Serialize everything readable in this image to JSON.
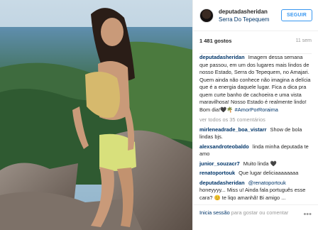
{
  "header": {
    "username": "deputadasheridan",
    "location": "Serra Do Tepequem",
    "follow_label": "SEGUIR"
  },
  "stats": {
    "likes": "1 481 gostos",
    "time_ago": "11 sem"
  },
  "caption": {
    "user": "deputadasheridan",
    "text": "Imagem dessa semana que passou, em um dos lugares mais lindos de nosso Estado, Serra do Tepequem, no Amajari. Quem ainda não conhece não imagina a delícia que é a energia daquele lugar. Fica a dica pra quem curte banho de cachoeira e uma vista maravilhosa! Nosso Estado é realmente lindo!",
    "signoff": "Bom dia!🖤🌴",
    "hashtag": "#AmorPorRoraima"
  },
  "view_all": "ver todos os 35 comentários",
  "comments": [
    {
      "user": "mirleneadrade_boa_vistarr",
      "text": "Show de bola lindas bjs."
    },
    {
      "user": "alexsandroteobaldo",
      "text": "linda minha deputada te amo"
    },
    {
      "user": "junior_souzacr7",
      "text": "Muito linda 🖤"
    },
    {
      "user": "renatoportouk",
      "text": "Que lugar deliciaaaaaaaa"
    },
    {
      "user": "deputadasheridan",
      "mention": "@renatoportouk",
      "text": "honeyyyy... Miss u! Ainda fala português esse cara? 😊 te liqo amanhã! Bi amigo ..."
    }
  ],
  "footer": {
    "login_link": "Inicia sessão",
    "login_rest": "para gostar ou comentar",
    "more_icon": "more-dots-icon"
  },
  "colors": {
    "link": "#003569",
    "accent": "#3897f0",
    "muted": "#999999"
  }
}
